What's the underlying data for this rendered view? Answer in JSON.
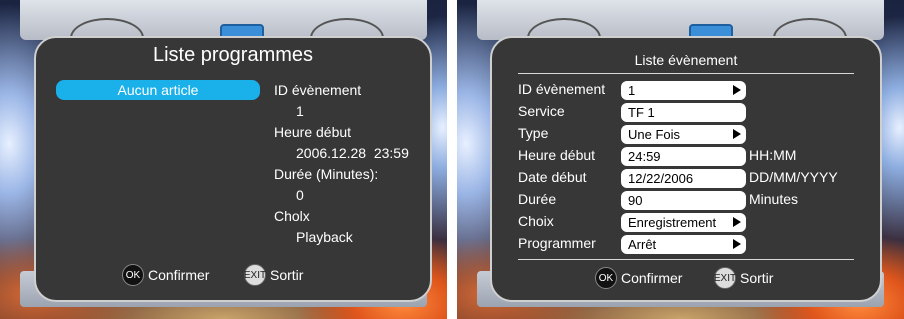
{
  "left": {
    "title": "Liste programmes",
    "selected_item": "Aucun article",
    "details": {
      "event_id_label": "ID évènement",
      "event_id_value": "1",
      "start_time_label": "Heure début",
      "start_time_value": "2006.12.28  23:59",
      "duration_label": "Durée (Minutes):",
      "duration_value": "0",
      "choice_label": "Cholx",
      "choice_value": "Playback"
    },
    "footer": {
      "ok_icon": "OK",
      "confirm_label": "Confirmer",
      "exit_icon": "EXIT",
      "exit_label": "Sortir"
    }
  },
  "right": {
    "title": "Liste évènement",
    "fields": [
      {
        "label": "ID évènement",
        "value": "1",
        "arrow": true,
        "unit": ""
      },
      {
        "label": "Service",
        "value": "TF 1",
        "arrow": false,
        "unit": ""
      },
      {
        "label": "Type",
        "value": "Une Fois",
        "arrow": true,
        "unit": ""
      },
      {
        "label": "Heure début",
        "value": "24:59",
        "arrow": false,
        "unit": "HH:MM"
      },
      {
        "label": "Date début",
        "value": "12/22/2006",
        "arrow": false,
        "unit": "DD/MM/YYYY"
      },
      {
        "label": "Durée",
        "value": "90",
        "arrow": false,
        "unit": "Minutes"
      },
      {
        "label": "Choix",
        "value": "Enregistrement",
        "arrow": true,
        "unit": ""
      },
      {
        "label": "Programmer",
        "value": "Arrêt",
        "arrow": true,
        "unit": ""
      }
    ],
    "footer": {
      "ok_icon": "OK",
      "confirm_label": "Confirmer",
      "exit_icon": "EXIT",
      "exit_label": "Sortir"
    }
  },
  "colors": {
    "panel": "#373737",
    "highlight": "#1ab0ea"
  }
}
